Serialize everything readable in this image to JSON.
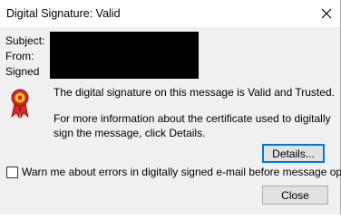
{
  "window": {
    "title": "Digital Signature: Valid",
    "close_icon": "close-icon"
  },
  "fields": {
    "subject_label": "Subject:",
    "from_label": "From:",
    "signed_label": "Signed"
  },
  "icons": {
    "signature": "ribbon-award-icon"
  },
  "message": {
    "status_text": "The digital signature on this message is Valid and Trusted.",
    "info_line1": "For more information about the certificate used to digitally",
    "info_line2": "sign the message, click Details."
  },
  "buttons": {
    "details_label": "Details...",
    "close_label": "Close"
  },
  "checkbox": {
    "label": "Warn me about errors in digitally signed e-mail before message opens.",
    "checked": false
  },
  "colors": {
    "dialog_bg": "#f0f0f0",
    "titlebar_bg": "#ffffff",
    "focus_border": "#0078d7",
    "button_bg": "#e1e1e1",
    "ribbon_red": "#d62828",
    "ribbon_gold": "#f2c230"
  }
}
